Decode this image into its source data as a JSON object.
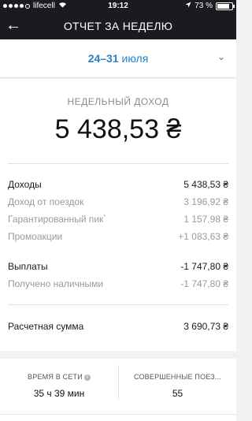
{
  "status_bar": {
    "carrier": "lifecell",
    "time": "19:12",
    "battery_text": "73 %",
    "battery_level": 0.73,
    "signal_bars_filled": 4,
    "signal_bars_total": 5
  },
  "header": {
    "back_icon": "←",
    "title": "ОТЧЕТ ЗА НЕДЕЛЮ"
  },
  "period": {
    "range": "24–31",
    "month": "июля",
    "chevron_icon": "⌄"
  },
  "summary": {
    "label": "НЕДЕЛЬНЫЙ ДОХОД",
    "total": "5 438,53 ₴"
  },
  "rows": {
    "income": {
      "label": "Доходы",
      "value": "5 438,53 ₴"
    },
    "trip_income": {
      "label": "Доход от поездок",
      "value": "3 196,92 ₴"
    },
    "guaranteed_peak": {
      "label": "Гарантированный пик",
      "mark": "*",
      "value": "1 157,98 ₴"
    },
    "promotions": {
      "label": "Промоакции",
      "value": "+1 083,63 ₴"
    },
    "payouts": {
      "label": "Выплаты",
      "value": "-1 747,80 ₴"
    },
    "cash_received": {
      "label": "Получено наличными",
      "value": "-1 747,80 ₴"
    },
    "settlement": {
      "label": "Расчетная сумма",
      "value": "3 690,73 ₴"
    }
  },
  "stats": {
    "online_time": {
      "label": "ВРЕМЯ В СЕТИ",
      "info_icon": "i",
      "value": "35 ч 39 мин"
    },
    "completed_trips": {
      "label": "СОВЕРШЕННЫЕ ПОЕЗ...",
      "value": "55"
    }
  },
  "colors": {
    "dark": "#1a1b1f",
    "accent": "#2a7fc1",
    "muted_text": "#9a9a9a",
    "background": "#f2f2f4"
  }
}
